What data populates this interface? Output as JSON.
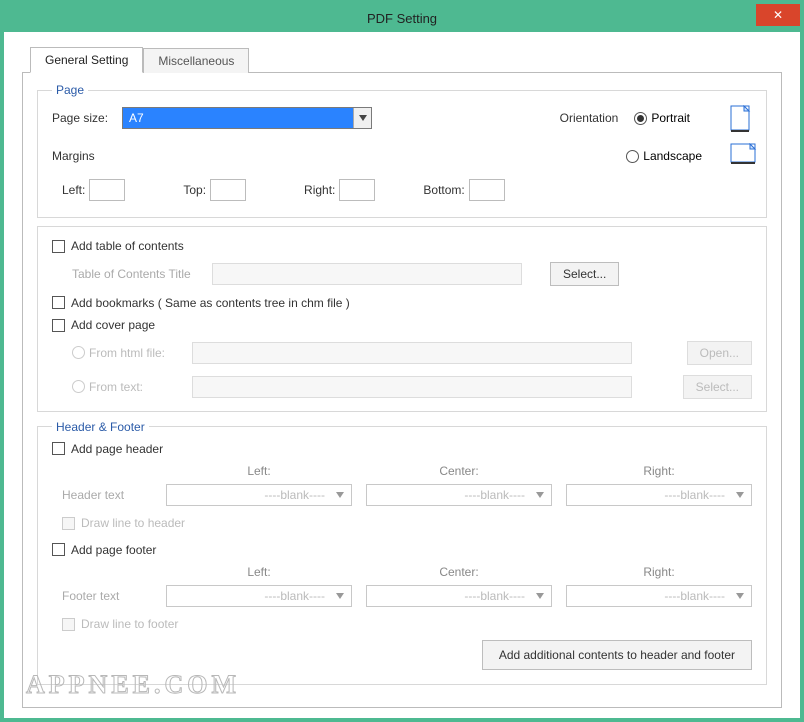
{
  "window": {
    "title": "PDF Setting"
  },
  "tabs": {
    "general": "General Setting",
    "misc": "Miscellaneous"
  },
  "page_group": {
    "legend": "Page",
    "page_size_label": "Page size:",
    "page_size_value": "A7",
    "orientation_label": "Orientation",
    "portrait_label": "Portrait",
    "landscape_label": "Landscape",
    "margins_label": "Margins",
    "left_label": "Left:",
    "top_label": "Top:",
    "right_label": "Right:",
    "bottom_label": "Bottom:",
    "left_value": "",
    "top_value": "",
    "right_value": "",
    "bottom_value": ""
  },
  "mid_group": {
    "add_toc_label": "Add table of contents",
    "toc_title_label": "Table of Contents Title",
    "toc_title_value": "",
    "toc_select_btn": "Select...",
    "add_bookmarks_label": "Add  bookmarks ( Same as contents tree in chm file )",
    "add_cover_label": "Add cover page",
    "from_html_label": "From html file:",
    "from_html_value": "",
    "open_btn": "Open...",
    "from_text_label": "From  text:",
    "from_text_value": "",
    "text_select_btn": "Select..."
  },
  "hf_group": {
    "legend": "Header & Footer",
    "add_header_label": "Add page header",
    "col_left": "Left:",
    "col_center": "Center:",
    "col_right": "Right:",
    "header_text_label": "Header text",
    "blank_value": "----blank----",
    "draw_line_header": "Draw line to header",
    "add_footer_label": "Add page footer",
    "footer_text_label": "Footer text",
    "draw_line_footer": "Draw line to footer",
    "add_additional_btn": "Add additional contents to header and footer"
  },
  "watermark": "APPNEE.COM"
}
